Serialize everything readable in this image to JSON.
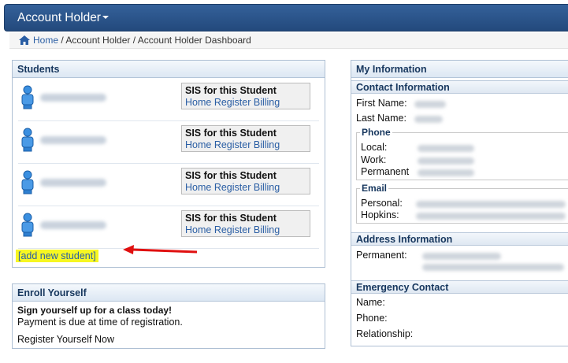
{
  "nav": {
    "brand": "Account Holder"
  },
  "breadcrumb": {
    "home": "Home",
    "separator": " / ",
    "parent": "Account Holder",
    "current": "Account Holder Dashboard"
  },
  "students": {
    "title": "Students",
    "rows": [
      {
        "sis_title": "SIS for this Student",
        "links": [
          "Home",
          "Register",
          "Billing"
        ]
      },
      {
        "sis_title": "SIS for this Student",
        "links": [
          "Home",
          "Register",
          "Billing"
        ]
      },
      {
        "sis_title": "SIS for this Student",
        "links": [
          "Home",
          "Register",
          "Billing"
        ]
      },
      {
        "sis_title": "SIS for this Student",
        "links": [
          "Home",
          "Register",
          "Billing"
        ]
      }
    ],
    "add_new": "[add new student]"
  },
  "enroll": {
    "title": "Enroll Yourself",
    "headline": "Sign yourself up for a class today!",
    "note": "Payment is due at time of registration.",
    "link": "Register Yourself Now"
  },
  "my_info": {
    "title": "My Information",
    "contact": {
      "title": "Contact Information",
      "first_name": "First Name:",
      "last_name": "Last Name:",
      "phone": {
        "legend": "Phone",
        "local": "Local:",
        "work": "Work:",
        "permanent": "Permanent"
      },
      "email": {
        "legend": "Email",
        "personal": "Personal:",
        "hopkins": "Hopkins:"
      }
    },
    "address": {
      "title": "Address Information",
      "permanent": "Permanent:"
    },
    "emergency": {
      "title": "Emergency Contact",
      "name": "Name:",
      "phone": "Phone:",
      "relationship": "Relationship:"
    }
  },
  "colors": {
    "nav": "#2b5488",
    "link": "#2a5ea4",
    "highlight": "#f7f722",
    "arrow": "#e01010"
  },
  "icons": {
    "home": "home-icon",
    "student": "user-icon",
    "arrow": "red-arrow-icon"
  }
}
